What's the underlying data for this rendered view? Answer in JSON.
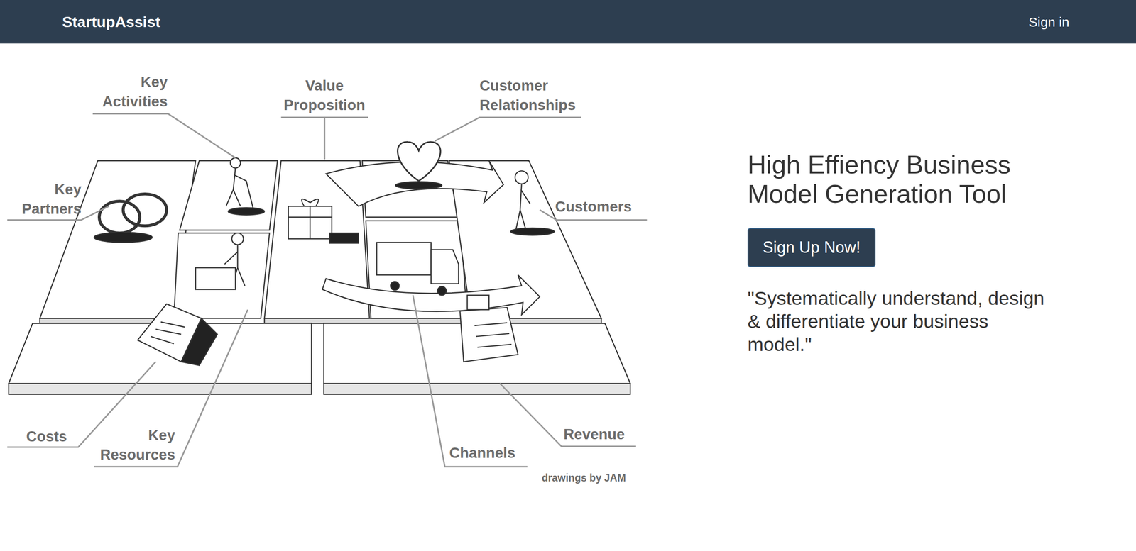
{
  "nav": {
    "logo": "StartupAssist",
    "sign_in": "Sign in"
  },
  "canvas": {
    "key_activities": "Key Activities",
    "value_proposition": "Value Proposition",
    "customer_relationships": "Customer Relationships",
    "key_partners": "Key Partners",
    "customers": "Customers",
    "costs": "Costs",
    "key_resources": "Key Resources",
    "channels": "Channels",
    "revenue": "Revenue",
    "credit": "drawings by JAM"
  },
  "hero": {
    "title": "High Effiency Business Model Generation Tool",
    "button": "Sign Up Now!",
    "quote": "\"Systematically understand, design & differentiate your business model.\""
  }
}
